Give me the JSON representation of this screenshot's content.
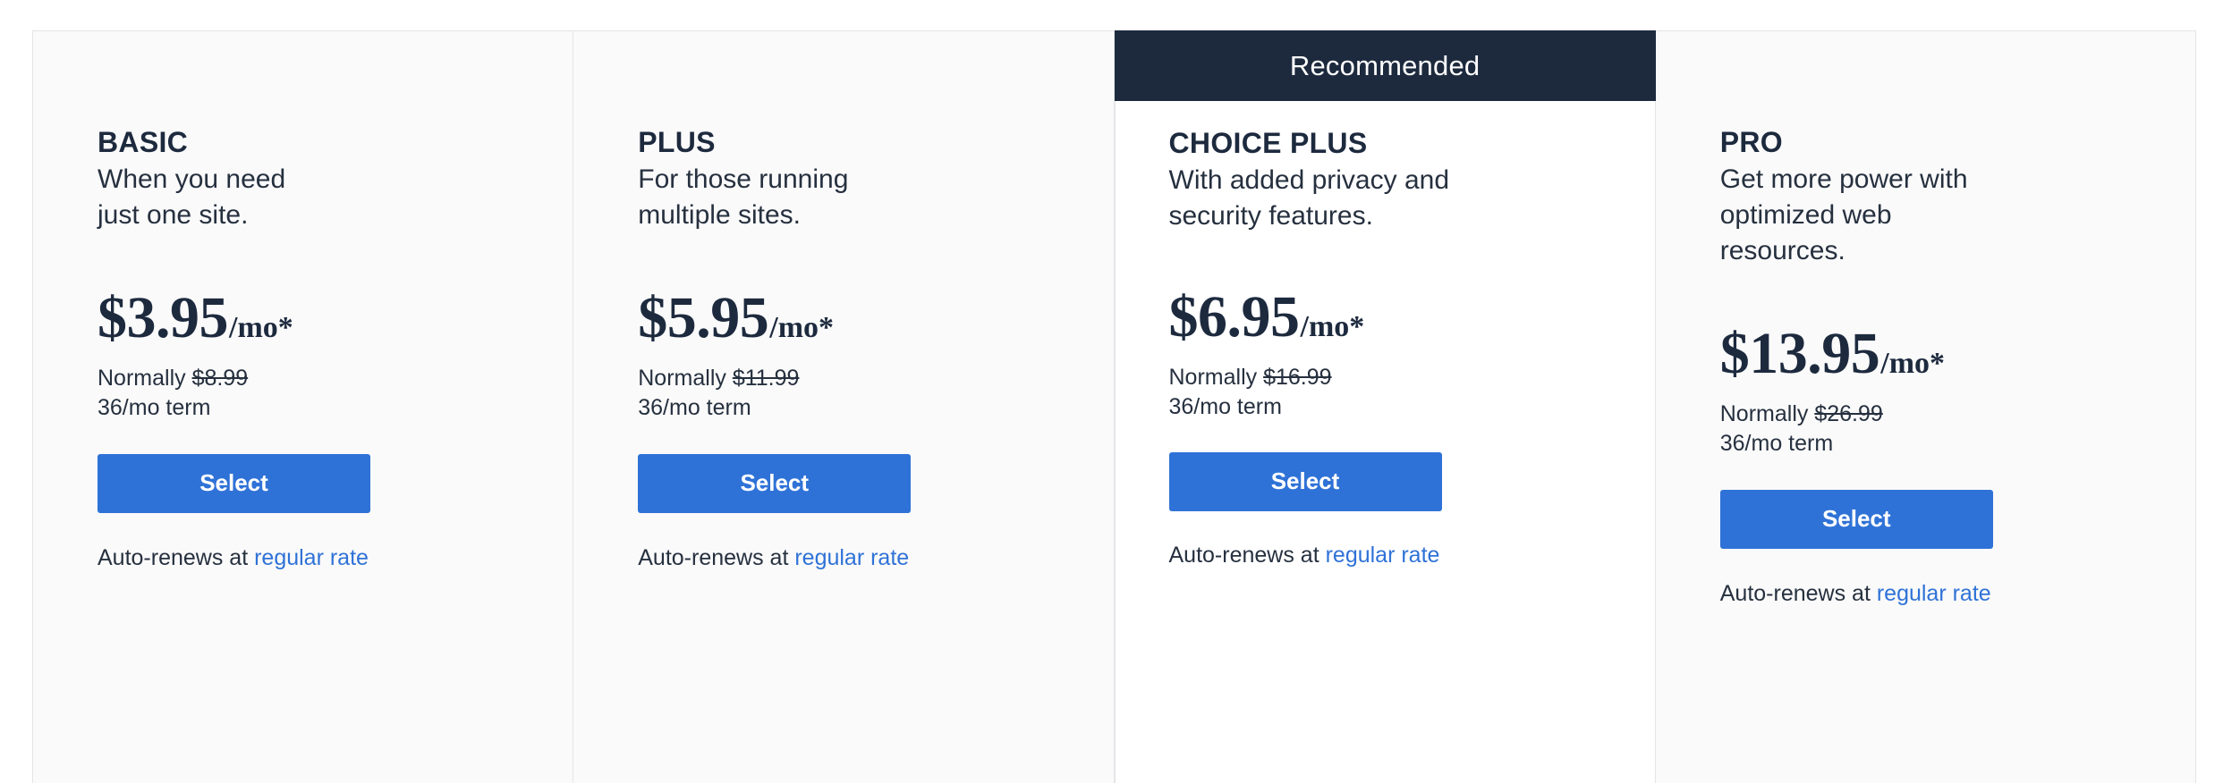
{
  "plans": [
    {
      "name": "BASIC",
      "description": "When you need\njust one site.",
      "price": "$3.95",
      "price_suffix": "/mo*",
      "normally_label": "Normally ",
      "normally_price": "$8.99",
      "term": "36/mo term",
      "select_label": "Select",
      "autorenew_prefix": "Auto-renews at ",
      "autorenew_link": "regular rate",
      "recommended": false,
      "ribbon_label": ""
    },
    {
      "name": "PLUS",
      "description": "For those running\nmultiple sites.",
      "price": "$5.95",
      "price_suffix": "/mo*",
      "normally_label": "Normally ",
      "normally_price": "$11.99",
      "term": "36/mo term",
      "select_label": "Select",
      "autorenew_prefix": "Auto-renews at ",
      "autorenew_link": "regular rate",
      "recommended": false,
      "ribbon_label": ""
    },
    {
      "name": "CHOICE PLUS",
      "description": "With added privacy and\nsecurity features.",
      "price": "$6.95",
      "price_suffix": "/mo*",
      "normally_label": "Normally ",
      "normally_price": "$16.99",
      "term": "36/mo term",
      "select_label": "Select",
      "autorenew_prefix": "Auto-renews at ",
      "autorenew_link": "regular rate",
      "recommended": true,
      "ribbon_label": "Recommended"
    },
    {
      "name": "PRO",
      "description": "Get more power with\noptimized web\nresources.",
      "price": "$13.95",
      "price_suffix": "/mo*",
      "normally_label": "Normally ",
      "normally_price": "$26.99",
      "term": "36/mo term",
      "select_label": "Select",
      "autorenew_prefix": "Auto-renews at ",
      "autorenew_link": "regular rate",
      "recommended": false,
      "ribbon_label": ""
    }
  ],
  "colors": {
    "accent_blue": "#2f72d7",
    "ribbon_navy": "#1d2a3e",
    "card_bg": "#fafafa",
    "recommended_bg": "#ffffff",
    "border": "#e4e6e8",
    "text_dark": "#1d2a3e"
  }
}
